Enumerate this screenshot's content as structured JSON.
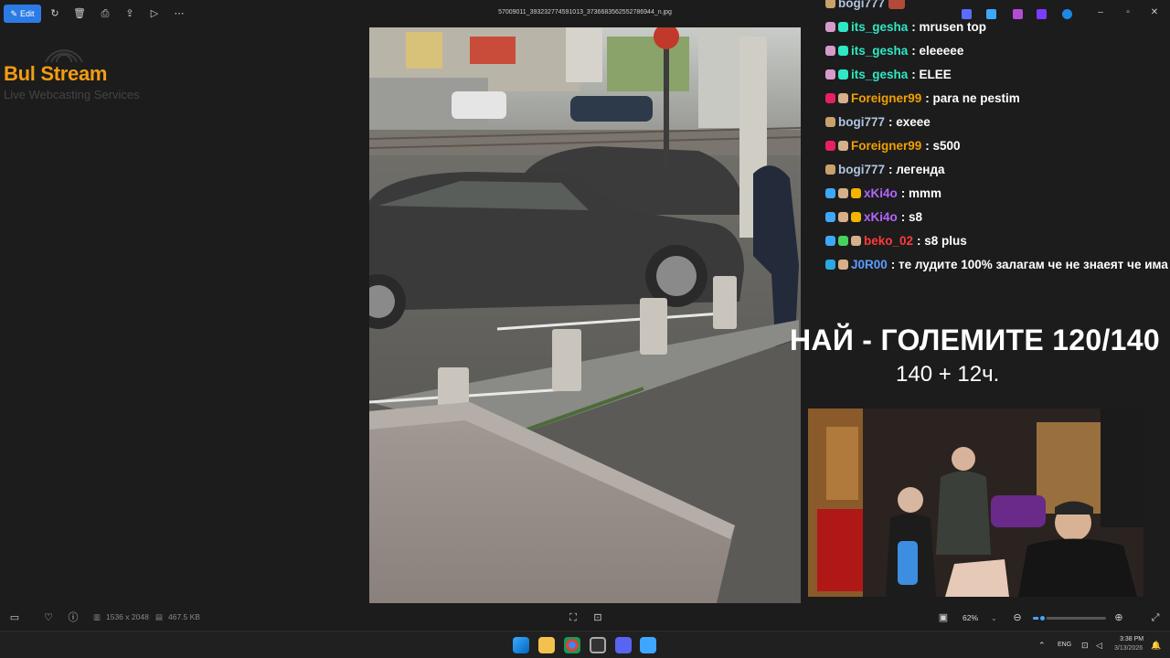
{
  "toolbar": {
    "edit_label": "Edit",
    "filename": "57009011_393232774591013_3736683562552786944_n.jpg"
  },
  "logo": {
    "main_text": "Bul  Stream",
    "sub_text": "Live Webcasting Services"
  },
  "chat": {
    "messages": [
      {
        "user": "bogi777",
        "text": "",
        "user_color": "#b0c4de",
        "badges": [
          "#c8a26a"
        ]
      },
      {
        "user": "its_gesha",
        "text": ": mrusen top",
        "user_color": "#2ee8c4",
        "badges": [
          "#d69acb",
          "#2ee8c4"
        ]
      },
      {
        "user": "its_gesha",
        "text": ": eleeeee",
        "user_color": "#2ee8c4",
        "badges": [
          "#d69acb",
          "#2ee8c4"
        ]
      },
      {
        "user": "its_gesha",
        "text": ": ELEE",
        "user_color": "#2ee8c4",
        "badges": [
          "#d69acb",
          "#2ee8c4"
        ]
      },
      {
        "user": "Foreigner99",
        "text": ": para ne pestim",
        "user_color": "#f0a000",
        "badges": [
          "#e91e63",
          "#d6b08a"
        ]
      },
      {
        "user": "bogi777",
        "text": ": exeee",
        "user_color": "#b0c4de",
        "badges": [
          "#c8a26a"
        ]
      },
      {
        "user": "Foreigner99",
        "text": ": s500",
        "user_color": "#f0a000",
        "badges": [
          "#e91e63",
          "#d6b08a"
        ]
      },
      {
        "user": "bogi777",
        "text": ": легенда",
        "user_color": "#b0c4de",
        "badges": [
          "#c8a26a"
        ]
      },
      {
        "user": "xKi4o",
        "text": ": mmm",
        "user_color": "#b266ff",
        "badges": [
          "#3da9fc",
          "#d6b08a",
          "#f5b400"
        ]
      },
      {
        "user": "xKi4o",
        "text": ": s8",
        "user_color": "#b266ff",
        "badges": [
          "#3da9fc",
          "#d6b08a",
          "#f5b400"
        ]
      },
      {
        "user": "beko_02",
        "text": ": s8 plus",
        "user_color": "#ff3b3b",
        "badges": [
          "#3da9fc",
          "#46d160",
          "#d6b08a"
        ]
      },
      {
        "user": "J0R00",
        "text": ": те лудите 100% залагам че не знаеят че има",
        "user_color": "#5b9cff",
        "badges": [
          "#27a9e1",
          "#d6b08a"
        ]
      }
    ]
  },
  "overlay": {
    "title": "НАЙ - ГОЛЕМИТЕ 120/140",
    "subtitle": "140 + 12ч."
  },
  "bottom_bar": {
    "dimensions": "1536 x 2048",
    "file_size": "467.5 KB",
    "zoom_value": "62%",
    "zoom_fraction": 0.12
  },
  "taskbar": {
    "language": "ENG",
    "time": "3:38 PM",
    "date": "3/13/2026"
  },
  "icons": {
    "edit": "edit-icon",
    "rotate": "rotate-icon",
    "delete": "delete-icon",
    "print": "print-icon",
    "share": "share-icon",
    "slideshow": "slideshow-icon",
    "more": "more-icon"
  }
}
